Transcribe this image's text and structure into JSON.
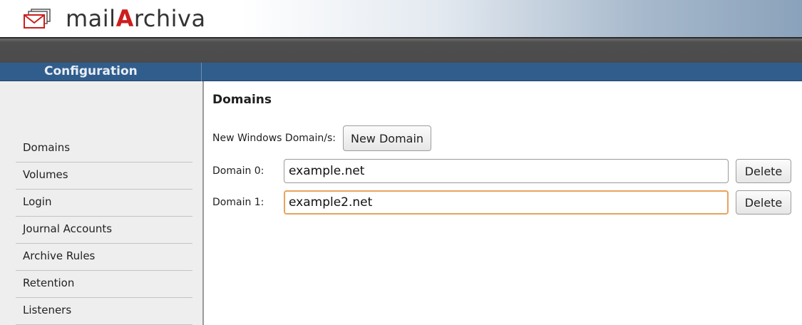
{
  "app": {
    "logo_mail": "mail",
    "logo_archiva_initial": "A",
    "logo_archiva_rest": "rchiva",
    "section": "Configuration"
  },
  "sidebar": {
    "items": [
      {
        "label": "Domains"
      },
      {
        "label": "Volumes"
      },
      {
        "label": "Login"
      },
      {
        "label": "Journal Accounts"
      },
      {
        "label": "Archive Rules"
      },
      {
        "label": "Retention"
      },
      {
        "label": "Listeners"
      }
    ]
  },
  "main": {
    "title": "Domains",
    "new_domain_label": "New Windows Domain/s:",
    "new_domain_button": "New Domain",
    "domains": [
      {
        "label": "Domain 0:",
        "value": "example.net",
        "delete_label": "Delete"
      },
      {
        "label": "Domain 1:",
        "value": "example2.net",
        "delete_label": "Delete"
      }
    ]
  },
  "colors": {
    "header_bar": "#4b4b4b",
    "title_bar": "#315d8c",
    "logo_accent": "#cc1e1e",
    "focus_border": "#e9a35d"
  },
  "icons": {
    "logo": "envelope-stack-icon"
  }
}
